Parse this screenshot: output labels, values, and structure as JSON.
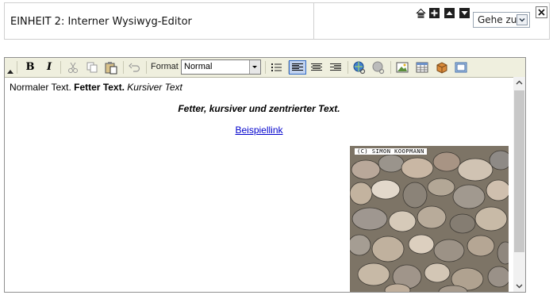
{
  "header": {
    "title": "EINHEIT 2: Interner Wysiwyg-Editor"
  },
  "controls": {
    "goto_label": "Gehe zu",
    "buttons": [
      "move-up-icon",
      "add-icon",
      "arrow-up-icon",
      "arrow-down-icon",
      "close-icon"
    ]
  },
  "toolbar": {
    "bold_label": "B",
    "italic_label": "I",
    "format_label": "Format",
    "format_value": "Normal"
  },
  "content": {
    "line1_normal": "Normaler Text. ",
    "line1_bold": "Fetter Text.",
    "line1_italic": " Kursiver Text",
    "line2": "Fetter, kursiver und zentrierter Text.",
    "link": "Beispiellink",
    "photo_credit": "(C) SIMON KOOPMANN"
  },
  "colors": {
    "toolbar_bg": "#efefde",
    "link": "#0000cc",
    "active_button": "#c1d2ee"
  }
}
